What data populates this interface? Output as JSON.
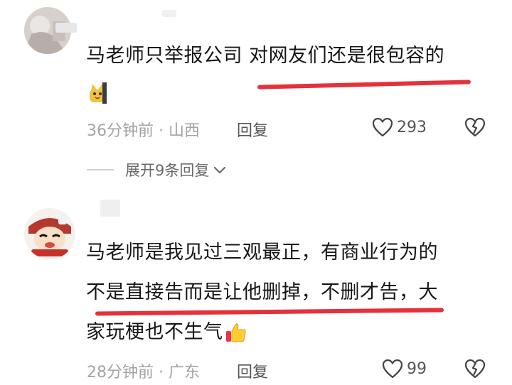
{
  "comments": [
    {
      "text_lines": [
        "马老师只举报公司 对网友们还是很包容的"
      ],
      "time_location": "36分钟前 · 山西",
      "reply_label": "回复",
      "like_count": "293",
      "expand_replies": "展开9条回复"
    },
    {
      "text_lines": [
        "马老师是我见过三观最正，有商业行为的",
        "不是直接告而是让他删掉，不删才告，大",
        "家玩梗也不生气"
      ],
      "time_location": "28分钟前 · 广东",
      "reply_label": "回复",
      "like_count": "99"
    }
  ],
  "colors": {
    "underline": "#e5313b",
    "meta_text": "#a4a4a4"
  },
  "icons": [
    "heart-outline-icon",
    "broken-heart-icon",
    "chevron-down-icon",
    "cat-emoji",
    "thumbs-up-emoji"
  ]
}
